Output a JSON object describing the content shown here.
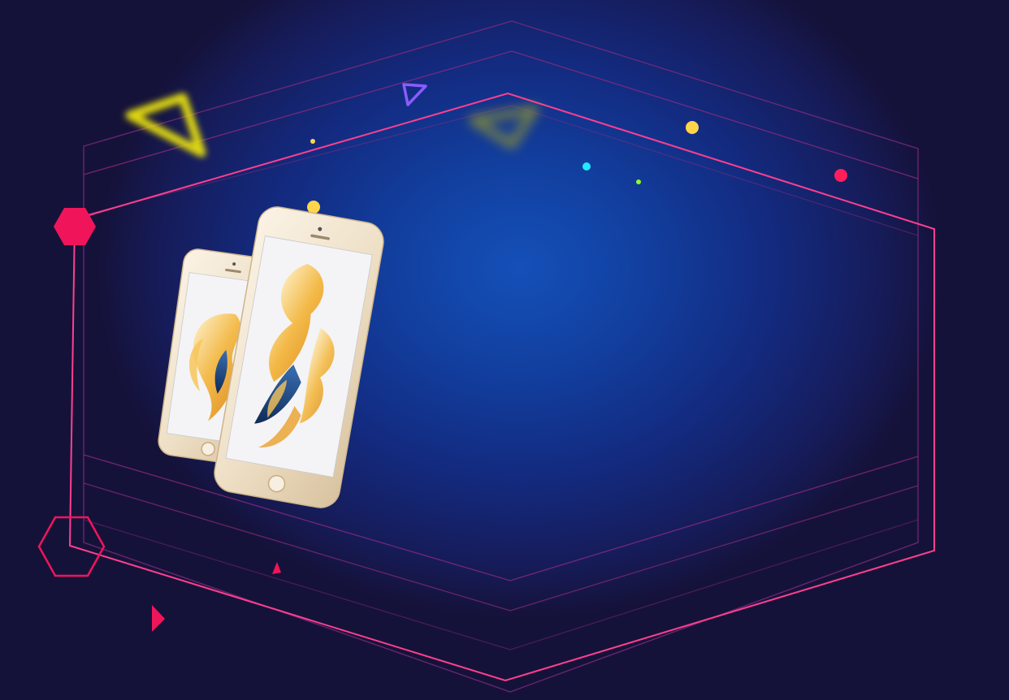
{
  "scene": {
    "background_colors": [
      "#15123a",
      "#1450b8"
    ],
    "accent_colors": {
      "frame_pink": "#ff3f8e",
      "frame_dim": "#b02c78",
      "hex_red": "#f0155a",
      "triangle_yellow": "#e8e011",
      "triangle_purple": "#8a5cff",
      "dot_yellow": "#ffd54a",
      "dot_cyan": "#22e8ff",
      "dot_green": "#8cff2a",
      "dot_pink": "#ff1e5a"
    },
    "icons": [
      "hexagon-filled-icon",
      "hexagon-outline-icon",
      "triangle-outline-icon",
      "triangle-play-icon",
      "dot-icon"
    ],
    "products": {
      "phone_finish": "gold",
      "wallpaper": "betta-fish"
    }
  }
}
